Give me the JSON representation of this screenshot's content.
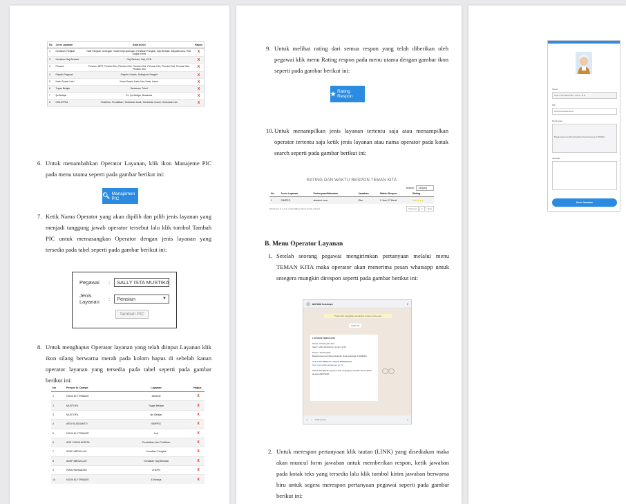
{
  "page1": {
    "kw_table": {
      "headers": [
        "No",
        "Jenis Layanan",
        "Kata Kunci",
        "Hapus"
      ],
      "rows": [
        [
          "1",
          "Kenaikan Pangkat",
          "Naik Pangkat, Golongan, masa kerja golongan, Kenaikan Pangkat, Gaji Berkala, Satyalencana, PAK, Angka Kredit",
          "X"
        ],
        [
          "2",
          "Kenaikan Gaji Berkala",
          "Gaji Berkala, Gaji, KGB",
          "X"
        ],
        [
          "3",
          "Pensiun",
          "Pensiun, MPP, Pensiun Dini, Pensiun Dini, Pensiun Dini, Pensiun Dini, Pensiun Dini, Pensiun Dini, Pensiun Dini",
          "X"
        ],
        [
          "4",
          "Disiplin Pegawai",
          "Disiplin, Hukdis, Selingkuh, Pangkit",
          "X"
        ],
        [
          "5",
          "Kartu Suami / Istri",
          "Kartu Suami, Kartu Istri, Karis, Karsu",
          "X"
        ],
        [
          "6",
          "Tugas Belajar",
          "Beasiswa, Tubel",
          "X"
        ],
        [
          "7",
          "Ijin Belajar",
          "S1, Ijin Belajar, Beasiswa",
          "X"
        ],
        [
          "8",
          "DIKLATPIM",
          "Pelatihan, Pendidikan, Tambahan Anak, Tambahan Suami, Tambahan Istri",
          "X"
        ]
      ]
    },
    "step6": {
      "num": "6.",
      "text": "Untuk menambahkan Operator Layanan, klik ikon Manajeme PIC pada menu utama seperti pada gambar berikut ini:"
    },
    "manajemen_button": "Manajemen PIC",
    "step7": {
      "num": "7.",
      "text": "Ketik Nama Operator yang akan dipilih dan pilih jenis layanan yang menjadi tanggung jawab operator tersebut lalu klik tombol Tambah PIC untuk memasangkan Operator dengan jenis layanan yang tersedia pada tabel seperti pada gambar berikut ini:"
    },
    "form7": {
      "pegawai_label": "Pegawai",
      "pegawai_value": "SALLY ISTA MUSTIKA, S",
      "jenis_label": "Jenis Layanan",
      "jenis_value": "Pensiun",
      "colon": ":",
      "button": "Tambah PIC"
    },
    "step8": {
      "num": "8.",
      "text": "Untuk menghapus Operator layanan yang telah diinput Layanan klik ikon silang berwarna merah pada kolom hapus di sebelah kanan operator layanan yang tersedia pada tabel seperti pada gambar berikut ini:"
    },
    "pic_table": {
      "headers": [
        "No",
        "Person In Charge",
        "Layanan",
        "Hapus"
      ],
      "rows": [
        [
          "1",
          "NOVA ELYTRAWATI",
          "Absensi",
          "X"
        ],
        [
          "2",
          "MUSTOFA",
          "Tugas Belajar",
          "X"
        ],
        [
          "3",
          "MUSTOFA",
          "Ijin Belajar",
          "X"
        ],
        [
          "4",
          "ARDI SUSDIANTO",
          "SIMPEG",
          "X"
        ],
        [
          "5",
          "NOVA ELYTRAWATI",
          "Cuti",
          "X"
        ],
        [
          "6",
          "ADE VIJAYA ARDITA",
          "Pendidikan dan Pelatihan",
          "X"
        ],
        [
          "7",
          "ADEP ABDULLAH",
          "Kenaikan Pangkat",
          "X"
        ],
        [
          "8",
          "ADEP ABDULLAH",
          "Kenaikan Gaji Berkala",
          "X"
        ],
        [
          "9",
          "RINA RAHMADINI",
          "LHKPN",
          "X"
        ],
        [
          "10",
          "NOVA ELYTRAWATI",
          "E-Kinerja",
          "X"
        ]
      ]
    }
  },
  "page2": {
    "step9": {
      "num": "9.",
      "text": "Untuk melihat rating dari semua respon yang telah diberikan oleh pegawai klik menu Rating respon pada menu utama dengan gambar ikon seperti pada gambar berikut ini:"
    },
    "rating_button": "Rating Respon",
    "step10": {
      "num": "10.",
      "text": "Untuk menampilkan jenis layanan tertentu saja atau menampilkan operator tertentu saja ketik jenis layanan atau nama operator pada kotak search seperti pada gambar berikut ini:"
    },
    "rating_table": {
      "title": "RATING DAN WAKTU RESPON TEMAN KITA",
      "search_label": "Search:",
      "search_value": "simpeg",
      "headers": [
        "No",
        "Jenis Layanan",
        "Pertanyaan/Masukan",
        "Jawaban",
        "Waktu Respon",
        "Rating"
      ],
      "row": [
        "1",
        "SIMPEG",
        "absensi error",
        "Oke",
        "0 Jam 37 Menit",
        "★★★★★"
      ],
      "footer": "Showing 1 to 1 of 1 entries (filtered from 3 total entries)",
      "prev": "Previous",
      "page": "1",
      "next": "Next"
    },
    "section_b": "B. Menu Operator Layanan",
    "stepB1": {
      "num": "1.",
      "text": "Setelah seorang pegawai mengirimkan pertanyaan melalui menu TEMAN KITA maka operator akan menerima pesan whatsapp untuk sesegera mungkin direspon seperti pada gambar berikut ini:"
    },
    "whatsapp": {
      "contact": "BKPSDM Kota Bogor",
      "system_msg": "Pesan dan panggilan terenkripsi secara end-to-end",
      "date": "HARI INI",
      "bubble_title": "LAYANAN TEMAN KITA",
      "bubble_lines": [
        "Nama / Pertanyaan dari:",
        "SALLY ISTA MUSTIKA, S.Kom, M.M",
        "Pesan / Pertanyaan:",
        "Bagaimana Cara Menambahkan Data Keluarga di SIMPEG",
        "KLIK LINK BERIKUT UNTUK MERESPON:"
      ],
      "bubble_link": "https://temankita.kotabogor.go.id/",
      "bubble_note": "Mohon Menjawab segera untuk menjaga kecepatan dan kualitas layanan BKPSDM",
      "input_placeholder": "Ketik pesan"
    },
    "stepB2": {
      "num": "2.",
      "text": "Untuk merespon pertanyaan klik tautan (LINK) yang disediakan maka akan muncul form jawaban untuk memberikan respon, ketik jawaban pada kotak teks yang tersedia lalu klik tombol kirim jawaban berwarna biru untuk segera merespon pertanyaan pegawai seperti pada gambar berikut ini:"
    }
  },
  "page3": {
    "form": {
      "nama_label": "Nama",
      "nama_value": "SALLY ISTA MUSTIKA, S.Kom, M.M",
      "nip_label": "NIP",
      "nip_value": "198101012010012002",
      "pertanyaan_label": "Pertanyaan",
      "pertanyaan_value": "Bagaimana Cara Menambahkan Data Keluarga di SIMPEG",
      "jawaban_label": "Jawaban",
      "jawaban_value": "",
      "button": "Kirim Jawaban"
    }
  },
  "colors": {
    "accent": "#2a8be0",
    "delete": "#e0211a"
  }
}
